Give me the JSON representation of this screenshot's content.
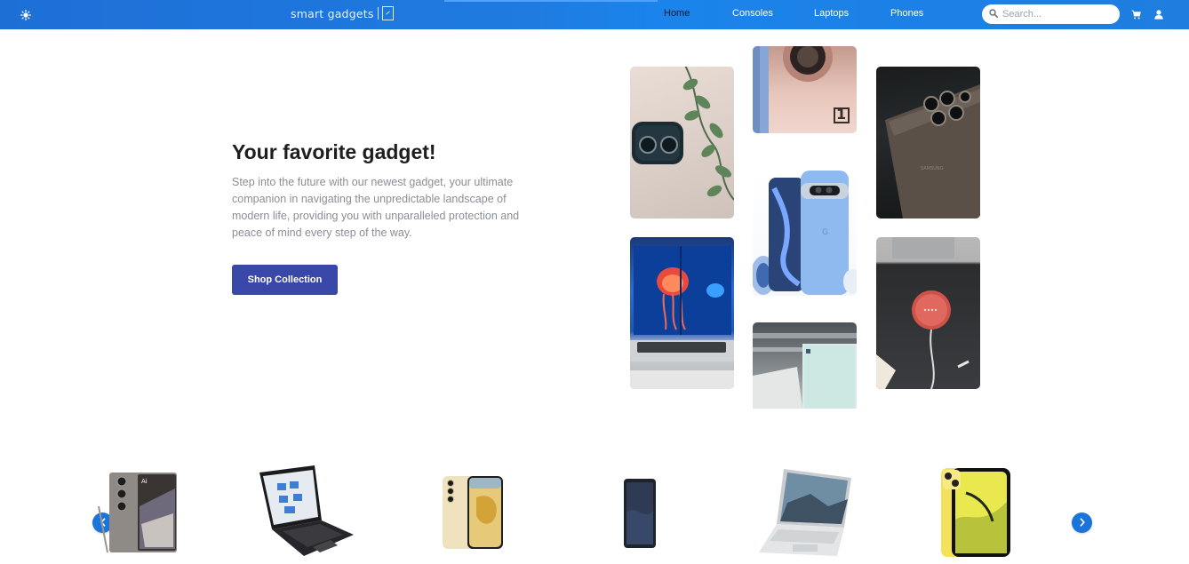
{
  "header": {
    "logo_text": "smart gadgets",
    "nav": [
      {
        "label": "Home",
        "active": true
      },
      {
        "label": "Consoles",
        "active": false
      },
      {
        "label": "Laptops",
        "active": false
      },
      {
        "label": "Phones",
        "active": false
      }
    ],
    "search": {
      "placeholder": "Search...",
      "value": ""
    },
    "icons": [
      "theme-toggle-icon",
      "search-icon",
      "cart-icon",
      "user-icon"
    ],
    "colors": {
      "bar": "#1f7be0",
      "active_nav": "#0c1a33"
    }
  },
  "hero": {
    "title": "Your favorite gadget!",
    "description": "Step into the future with our newest gadget, your ultimate companion in navigating the unpredictable landscape of modern life, providing you with unparalleled protection and peace of mind every step of the way.",
    "cta_label": "Shop Collection",
    "cta_color": "#3948a8",
    "gallery": [
      "earbuds-case-image",
      "pink-phone-camera-image",
      "dark-phone-back-image",
      "dual-screen-laptop-image",
      "blue-pixel-phone-image",
      "red-smart-speaker-image",
      "white-console-image"
    ]
  },
  "carousel": {
    "prev_icon": "chevron-left-icon",
    "next_icon": "chevron-right-icon",
    "products": [
      "grey-galaxy-phone",
      "black-laptop",
      "yellow-galaxy-phone",
      "small-dark-phone",
      "silver-laptop",
      "yellow-iphone"
    ]
  }
}
